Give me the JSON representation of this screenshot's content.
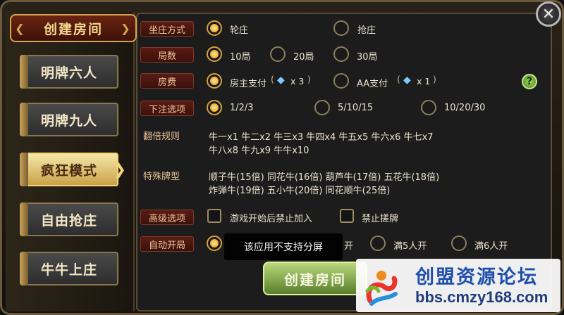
{
  "header": {
    "title": "创建房间"
  },
  "modes": [
    {
      "label": "明牌六人",
      "active": false
    },
    {
      "label": "明牌九人",
      "active": false
    },
    {
      "label": "疯狂模式",
      "active": true
    },
    {
      "label": "自由抢庄",
      "active": false
    },
    {
      "label": "牛牛上庄",
      "active": false
    }
  ],
  "rows": {
    "banker": {
      "label": "坐庄方式",
      "options": [
        "轮庄",
        "抢庄"
      ],
      "selected": 0
    },
    "rounds": {
      "label": "局数",
      "options": [
        "10局",
        "20局",
        "30局"
      ],
      "selected": 0
    },
    "fee": {
      "label": "房费",
      "options": [
        "房主支付",
        "AA支付"
      ],
      "amounts": [
        "x 3",
        "x 1"
      ],
      "selected": 0
    },
    "bet": {
      "label": "下注选项",
      "options": [
        "1/2/3",
        "5/10/15",
        "10/20/30"
      ],
      "selected": 0
    },
    "multiply": {
      "label": "翻倍规则",
      "line1": "牛一x1 牛二x2 牛三x3 牛四x4 牛五x5 牛六x6 牛七x7",
      "line2": "牛八x8 牛九x9 牛牛x10"
    },
    "special": {
      "label": "特殊牌型",
      "line1": "顺子牛(15倍) 同花牛(16倍) 葫芦牛(17倍) 五花牛(18倍)",
      "line2": "炸弹牛(19倍) 五小牛(20倍) 同花顺牛(25倍)"
    },
    "advanced": {
      "label": "高级选项",
      "options": [
        "游戏开始后禁止加入",
        "禁止搓牌"
      ]
    },
    "autostart": {
      "label": "自动开局",
      "options": [
        "满5人开",
        "满6人开"
      ],
      "partial": "开"
    }
  },
  "toast": "该应用不支持分屏",
  "create_button": "创建房间",
  "close_icon": "close-icon",
  "help_icon": "help-icon",
  "help_glyph": "?",
  "watermark": {
    "title": "创盟资源论坛",
    "url": "bbs.cmzy168.com"
  },
  "colors": {
    "accent_gold": "#d9a13b",
    "label_red": "#5a1c14",
    "create_green": "#7fa33c"
  }
}
